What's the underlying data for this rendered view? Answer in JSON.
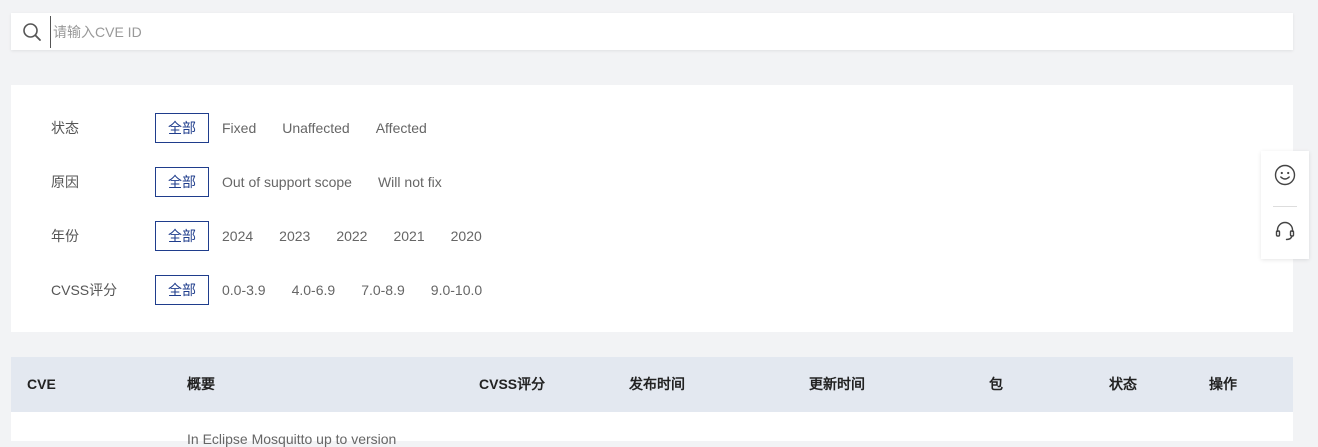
{
  "search": {
    "placeholder": "请输入CVE ID"
  },
  "filters": [
    {
      "label": "状态",
      "options": [
        "全部",
        "Fixed",
        "Unaffected",
        "Affected"
      ],
      "selected": 0
    },
    {
      "label": "原因",
      "options": [
        "全部",
        "Out of support scope",
        "Will not fix"
      ],
      "selected": 0
    },
    {
      "label": "年份",
      "options": [
        "全部",
        "2024",
        "2023",
        "2022",
        "2021",
        "2020"
      ],
      "selected": 0
    },
    {
      "label": "CVSS评分",
      "options": [
        "全部",
        "0.0-3.9",
        "4.0-6.9",
        "7.0-8.9",
        "9.0-10.0"
      ],
      "selected": 0
    }
  ],
  "table": {
    "columns": [
      "CVE",
      "概要",
      "CVSS评分",
      "发布时间",
      "更新时间",
      "包",
      "状态",
      "操作"
    ],
    "rows": [
      {
        "summary": "In Eclipse Mosquitto up to version"
      }
    ]
  },
  "side": {
    "feedback_icon": "smiley-icon",
    "support_icon": "headset-icon"
  },
  "colors": {
    "accent": "#1f3d8c",
    "header_bg": "#e3e8f0",
    "page_bg": "#f2f3f5"
  }
}
